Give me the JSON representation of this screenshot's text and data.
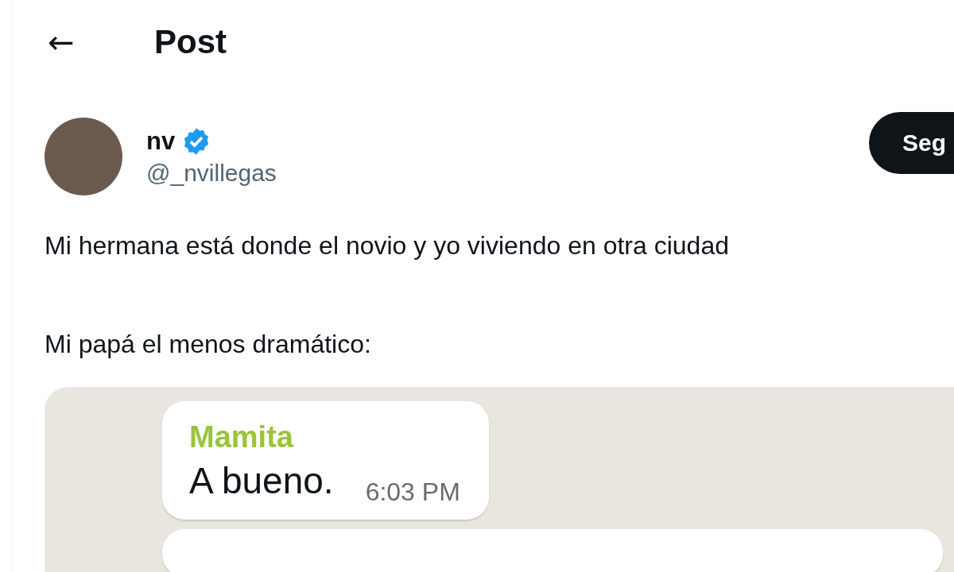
{
  "header": {
    "back_icon": "←",
    "title": "Post"
  },
  "author": {
    "name": "nv",
    "verified": true,
    "handle": "@_nvillegas",
    "follow_button": "Seg"
  },
  "post": {
    "paragraphs": [
      "Mi hermana está donde el novio y yo viviendo en otra ciudad",
      "Mi papá el menos dramático:"
    ],
    "image": {
      "messages": [
        {
          "kind": "full",
          "sender": "Mamita",
          "text": "A bueno.",
          "time": "6:03 PM"
        },
        {
          "kind": "cut_off"
        }
      ]
    }
  }
}
